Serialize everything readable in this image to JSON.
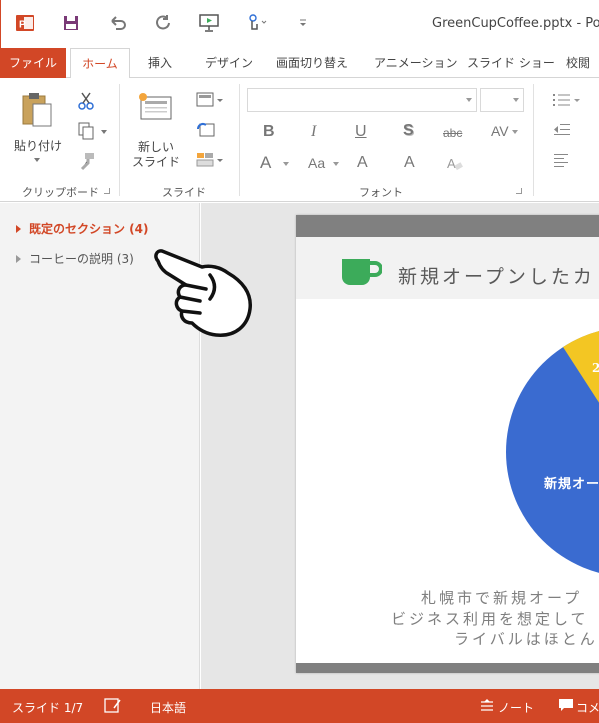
{
  "app": {
    "window_title": "GreenCupCoffee.pptx - Powe"
  },
  "quick_access": [
    {
      "icon": "powerpoint-logo-icon"
    },
    {
      "icon": "save-icon"
    },
    {
      "icon": "undo-icon"
    },
    {
      "icon": "redo-icon"
    },
    {
      "icon": "start-slideshow-icon"
    },
    {
      "icon": "touch-mode-icon"
    },
    {
      "icon": "customize-qat-icon"
    }
  ],
  "tabs": [
    {
      "label": "ファイル"
    },
    {
      "label": "ホーム"
    },
    {
      "label": "挿入"
    },
    {
      "label": "デザイン"
    },
    {
      "label": "画面切り替え"
    },
    {
      "label": "アニメーション"
    },
    {
      "label": "スライド ショー"
    },
    {
      "label": "校閲"
    }
  ],
  "ribbon": {
    "clipboard": {
      "paste_label": "貼り付け",
      "group_label": "クリップボード"
    },
    "slides": {
      "new_slide_line1": "新しい",
      "new_slide_line2": "スライド",
      "group_label": "スライド"
    },
    "font": {
      "group_label": "フォント",
      "bold": "B",
      "italic": "I",
      "underline": "U",
      "shadow": "S",
      "strike": "abc",
      "spacing": "AV",
      "grow": "A",
      "case": "Aa",
      "shrink": "A",
      "color": "A"
    }
  },
  "sections": [
    {
      "label": "既定のセクション (4)",
      "active": true
    },
    {
      "label": "コーヒーの説明 (3)",
      "active": false
    }
  ],
  "slide": {
    "title": "新規オープンしたカ",
    "pie_label": "新規オー",
    "pie_small_label": "2",
    "body_lines": [
      "札幌市で新規オープ",
      "ビジネス利用を想定して",
      "ライバルはほとん"
    ],
    "colors": {
      "cup": "#3cab5a",
      "pie_blue": "#3a6bd0",
      "pie_yellow": "#f3c623",
      "bar": "#808080"
    }
  },
  "status": {
    "slide_counter": "スライド 1/7",
    "language": "日本語",
    "notes": "ノート",
    "comments": "コメン"
  },
  "colors": {
    "accent": "#d24726"
  }
}
